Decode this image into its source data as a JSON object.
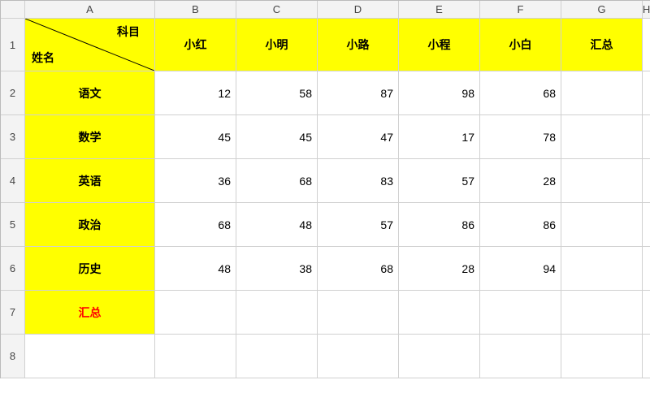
{
  "columns": [
    "A",
    "B",
    "C",
    "D",
    "E",
    "F",
    "G",
    "H"
  ],
  "row_numbers": [
    "1",
    "2",
    "3",
    "4",
    "5",
    "6",
    "7",
    "8"
  ],
  "diag_header": {
    "top": "科目",
    "bottom": "姓名"
  },
  "col_headers": [
    "小红",
    "小明",
    "小路",
    "小程",
    "小白",
    "汇总"
  ],
  "row_labels": [
    "语文",
    "数学",
    "英语",
    "政治",
    "历史",
    "汇总"
  ],
  "data": [
    [
      12,
      58,
      87,
      98,
      68
    ],
    [
      45,
      45,
      47,
      17,
      78
    ],
    [
      36,
      68,
      83,
      57,
      28
    ],
    [
      68,
      48,
      57,
      86,
      86
    ],
    [
      48,
      38,
      68,
      28,
      94
    ]
  ]
}
